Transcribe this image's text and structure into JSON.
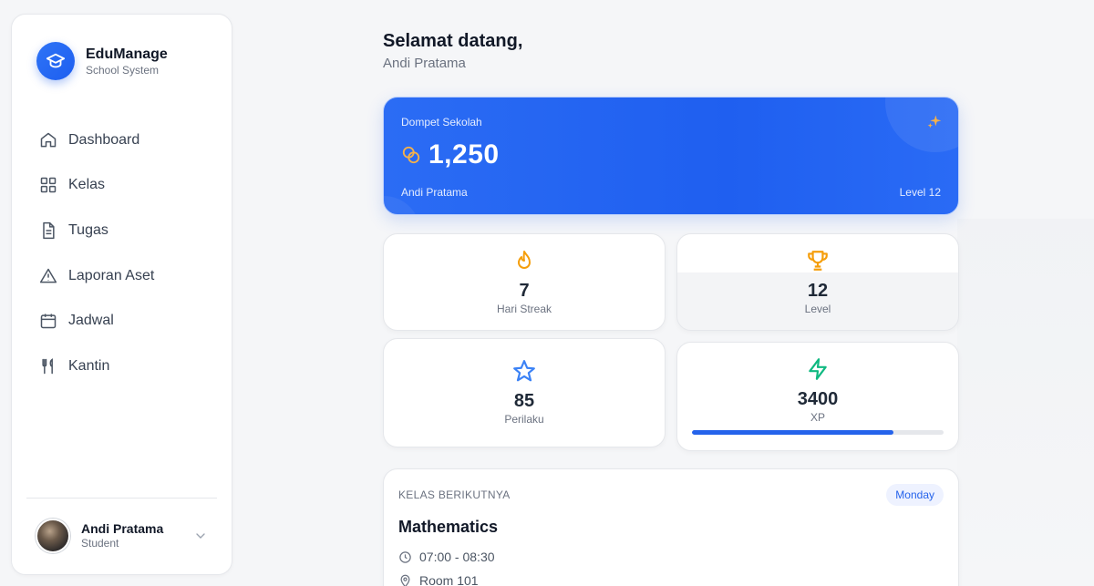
{
  "brand": {
    "name": "EduManage",
    "subtitle": "School System",
    "logo_icon": "graduation-cap-icon"
  },
  "nav": [
    {
      "label": "Dashboard",
      "icon": "home-icon"
    },
    {
      "label": "Kelas",
      "icon": "grid-icon"
    },
    {
      "label": "Tugas",
      "icon": "document-icon"
    },
    {
      "label": "Laporan Aset",
      "icon": "warning-icon"
    },
    {
      "label": "Jadwal",
      "icon": "calendar-icon"
    },
    {
      "label": "Kantin",
      "icon": "utensils-icon"
    }
  ],
  "user": {
    "name": "Andi Pratama",
    "role": "Student"
  },
  "greeting": {
    "title": "Selamat datang,",
    "name": "Andi Pratama"
  },
  "wallet": {
    "label": "Dompet Sekolah",
    "amount": "1,250",
    "owner": "Andi Pratama",
    "level": "Level 12",
    "accent": "#2563eb"
  },
  "stats": {
    "streak": {
      "value": "7",
      "label": "Hari Streak",
      "icon": "flame-icon",
      "color": "#f59e0b"
    },
    "level": {
      "value": "12",
      "label": "Level",
      "icon": "trophy-icon",
      "color": "#f59e0b"
    },
    "behavior": {
      "value": "85",
      "label": "Perilaku",
      "icon": "star-icon",
      "color": "#3b82f6"
    },
    "xp": {
      "value": "3400",
      "label": "XP",
      "icon": "lightning-icon",
      "color": "#10b981",
      "progress": 0.8
    }
  },
  "next_class": {
    "heading": "KELAS BERIKUTNYA",
    "day": "Monday",
    "subject": "Mathematics",
    "time": "07:00 - 08:30",
    "room": "Room 101"
  }
}
